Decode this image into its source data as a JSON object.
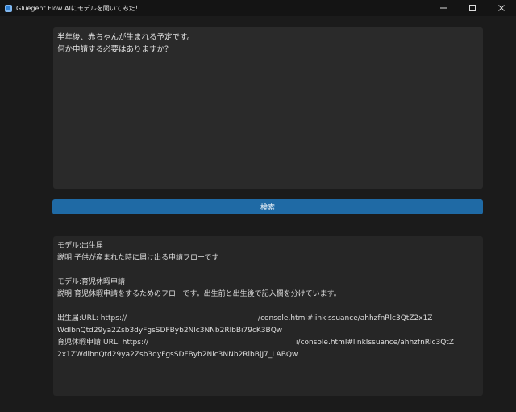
{
  "window": {
    "title": "Gluegent Flow AIにモデルを聞いてみた！",
    "accent": "#1f6aa5"
  },
  "query": {
    "lines": [
      "半年後、赤ちゃんが生まれる予定です。",
      "何か申請する必要はありますか？"
    ]
  },
  "search_button": {
    "label": "検索"
  },
  "results": {
    "model1_label": "モデル:出生届",
    "model1_desc": "説明:子供が産まれた時に届け出る申請フローです",
    "model2_label": "モデル:育児休暇申請",
    "model2_desc": "説明:育児休暇申請をするためのフローです。出生前と出生後で記入欄を分けています。",
    "url1_prefix": "出生届:URL: https://",
    "url1_suffix": "/console.html#linkIssuance/ahhzfnRlc3QtZ2x1Z",
    "url1_cont": "WdlbnQtd29ya2Zsb3dyFgsSDFByb2Nlc3NNb2RlbBi79cK3BQw",
    "url2_prefix": "育児休暇申請:URL: https://",
    "url2_suffix": "ı/console.html#linkIssuance/ahhzfnRlc3QtZ",
    "url2_cont": "2x1ZWdlbnQtd29ya2Zsb3dyFgsSDFByb2Nlc3NNb2RlbBjJ7_LABQw"
  }
}
